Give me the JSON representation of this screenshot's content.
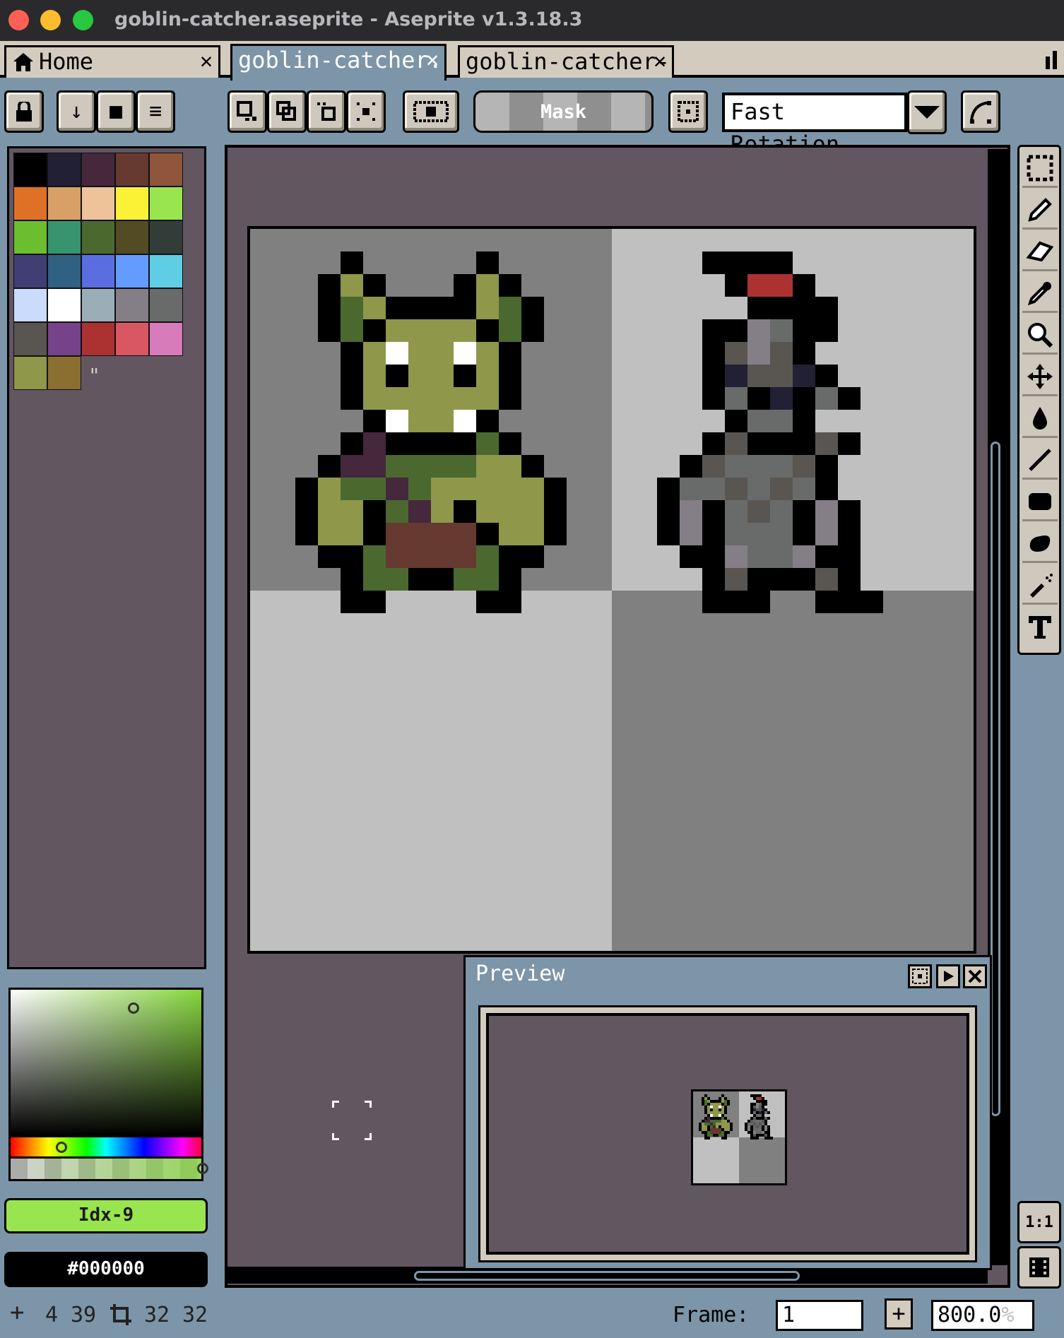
{
  "window": {
    "title": "goblin-catcher.aseprite - Aseprite v1.3.18.3"
  },
  "tabs": [
    {
      "label": "Home",
      "close": "✕"
    },
    {
      "label": "goblin-catcher.",
      "close": "✕"
    },
    {
      "label": "goblin-catcher-",
      "close": "✕"
    }
  ],
  "toolbar": {
    "mask_label": "Mask",
    "rotation_value": "Fast Rotation",
    "rotation_options": [
      "Fast Rotation"
    ]
  },
  "palette": {
    "colors": [
      "#000000",
      "#222034",
      "#45283c",
      "#663931",
      "#8f563b",
      "#df7126",
      "#d9a066",
      "#eec39a",
      "#fbf236",
      "#99e550",
      "#6abe30",
      "#37946e",
      "#4b692f",
      "#524b24",
      "#323c39",
      "#3f3f74",
      "#306082",
      "#5b6ee1",
      "#639bff",
      "#5fcde4",
      "#cbdbfc",
      "#ffffff",
      "#9badb7",
      "#847e87",
      "#696a6a",
      "#595652",
      "#76428a",
      "#ac3232",
      "#d95763",
      "#d77bba",
      "#8f974a",
      "#8a6f30"
    ],
    "resize_handle": "\""
  },
  "color": {
    "foreground": "Idx-9",
    "foreground_color": "#99e550",
    "background": "#000000",
    "background_color": "#000000"
  },
  "preview": {
    "title": "Preview"
  },
  "status": {
    "pos_x": "4",
    "pos_y": "39",
    "size_w": "32",
    "size_h": "32",
    "frame_label": "Frame:",
    "frame_value": "1",
    "zoom_value": "800.0",
    "zoom_unit": "%"
  },
  "tools_bottom": {
    "zoom_1to1": "1:1"
  }
}
